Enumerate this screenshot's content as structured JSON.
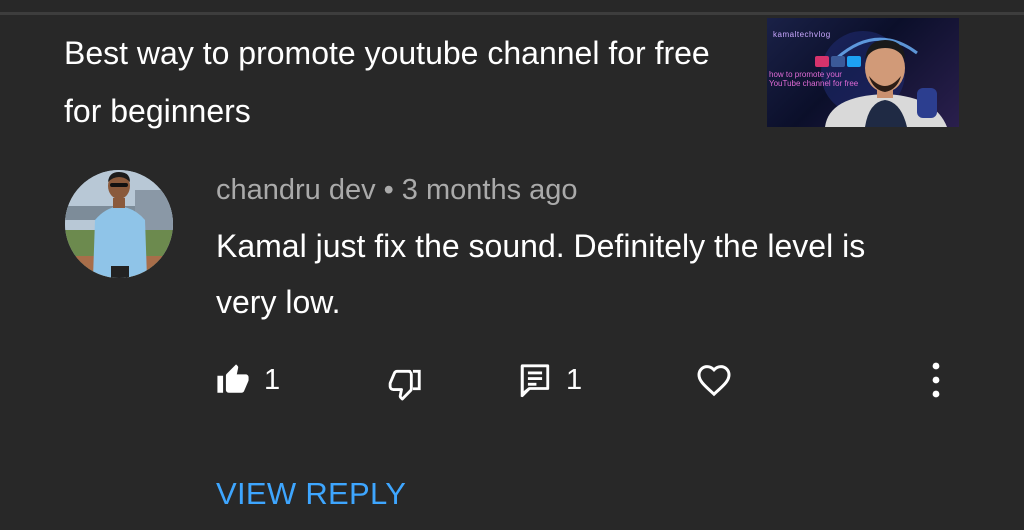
{
  "video": {
    "title": "Best way to promote youtube channel for free for beginners",
    "thumbnail": {
      "channel_text": "kamaltechvlog",
      "caption": "how to promote your YouTube channel for free"
    }
  },
  "comment": {
    "author": "chandru dev",
    "separator": "•",
    "time": "3 months ago",
    "text": "Kamal just fix the sound. Definitely the level is very low.",
    "like_count": "1",
    "reply_count": "1"
  },
  "actions": {
    "like_icon": "thumbs-up-icon",
    "dislike_icon": "thumbs-down-icon",
    "reply_icon": "comment-icon",
    "heart_icon": "heart-icon",
    "more_icon": "more-vertical-icon"
  },
  "view_reply_label": "VIEW REPLY",
  "colors": {
    "background": "#282828",
    "text_primary": "#ffffff",
    "text_secondary": "#aaaaaa",
    "accent": "#3ea6ff"
  }
}
